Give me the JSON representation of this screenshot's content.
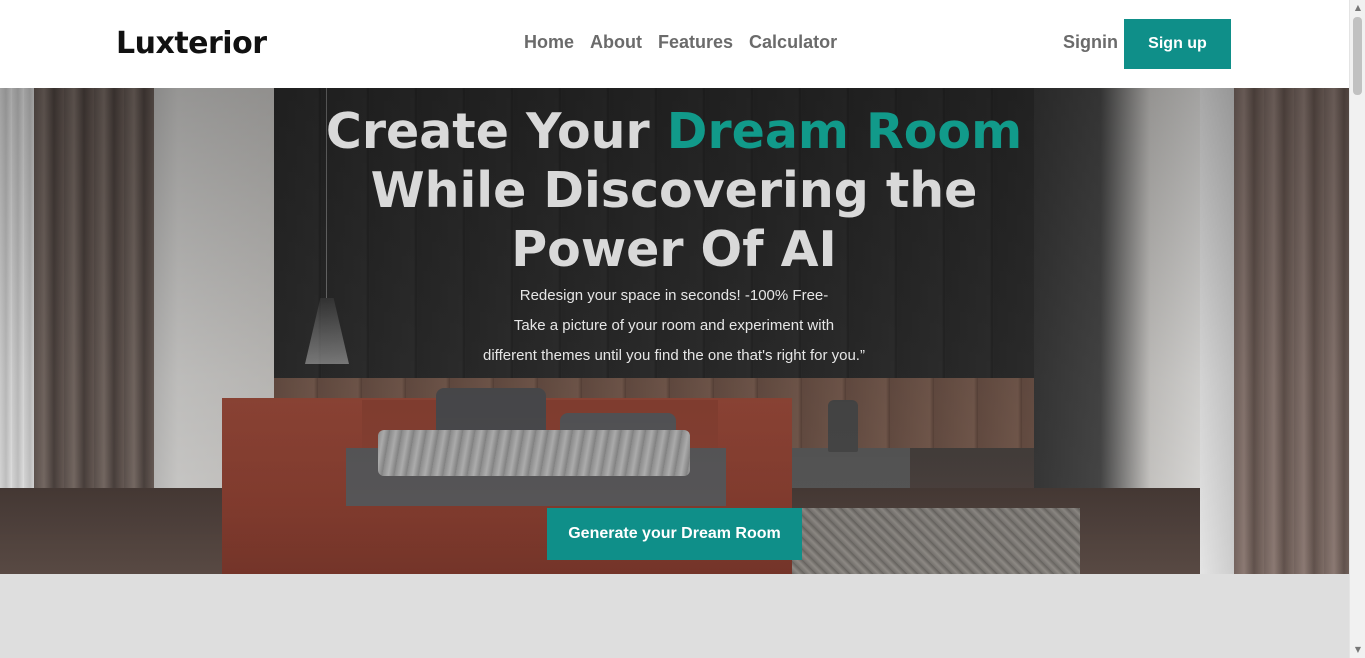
{
  "navbar": {
    "logo": "Luxterior",
    "links": [
      "Home",
      "About",
      "Features",
      "Calculator"
    ],
    "signin": "Signin",
    "signup": "Sign up"
  },
  "hero": {
    "title_part1": "Create Your ",
    "title_accent": "Dream Room",
    "title_part2": "While Discovering the Power Of AI",
    "subtitle_line1": "Redesign your space in seconds! -100% Free-",
    "subtitle_line2": "Take a picture of your room and experiment with",
    "subtitle_line3": "different themes until you find the one that's right for you.”",
    "cta": "Generate your Dream Room"
  },
  "colors": {
    "accent": "#0f8f89",
    "accent_text": "#119a8a",
    "nav_text": "#6b6b6b",
    "page_bg": "#dedede"
  }
}
